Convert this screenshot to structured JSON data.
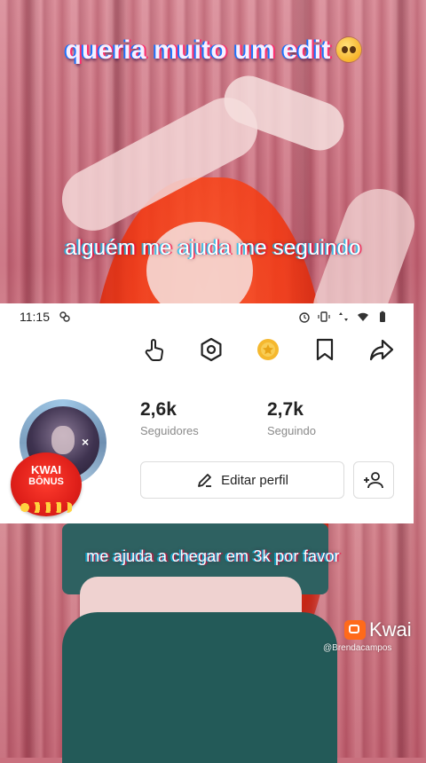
{
  "captions": {
    "top": "queria muito um edit",
    "middle": "alguém me ajuda me seguindo",
    "bottom": "me ajuda a chegar em 3k por favor"
  },
  "status_bar": {
    "time": "11:15",
    "icons": [
      "notification-icon",
      "alarm-icon",
      "vibrate-icon",
      "data-arrows-icon",
      "wifi-icon",
      "battery-icon"
    ]
  },
  "toolbar": {
    "icons": [
      "hand-pointer-icon",
      "hexagon-settings-icon",
      "coin-icon",
      "bookmark-icon",
      "share-icon"
    ]
  },
  "profile": {
    "bonus_line1": "KWAI",
    "bonus_line2": "BÔNUS",
    "avatar_close": "×",
    "followers_count": "2,6k",
    "followers_label": "Seguidores",
    "following_count": "2,7k",
    "following_label": "Seguindo",
    "edit_button": "Editar perfil"
  },
  "watermark": {
    "brand": "Kwai",
    "handle": "@Brendacampos"
  },
  "colors": {
    "coin": "#f5b82e",
    "bonus_red": "#e0201a",
    "kwai_orange": "#ff6a1a",
    "teal_cloth": "#2e6161"
  }
}
